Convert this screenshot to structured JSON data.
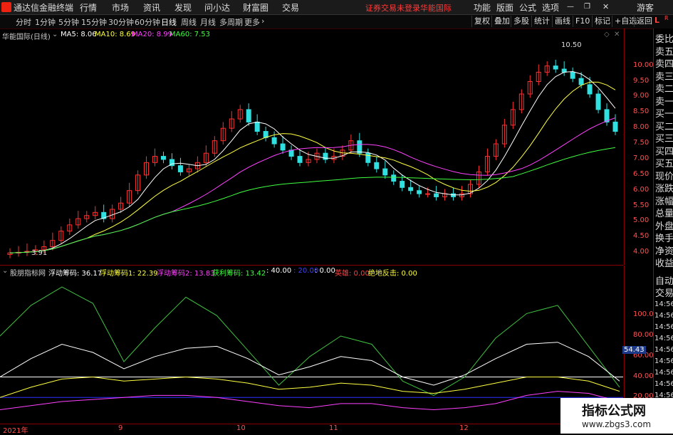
{
  "menubar": {
    "app_title": "通达信金融终端",
    "items": [
      "行情",
      "市场",
      "资讯",
      "发现",
      "问小达",
      "财富圈",
      "交易"
    ],
    "login_notice": "证券交易未登录",
    "stock_link": "华能国际",
    "right_items": [
      "功能",
      "版面",
      "公式",
      "选项"
    ],
    "user": "游客"
  },
  "toolbar": {
    "periods": [
      "分时",
      "1分钟",
      "5分钟",
      "15分钟",
      "30分钟",
      "60分钟",
      "日线",
      "周线",
      "月线",
      "多周期",
      "更多"
    ],
    "active_period": "日线",
    "right_buttons": [
      "复权",
      "叠加",
      "多股",
      "统计",
      "画线",
      "F10",
      "标记",
      "+自选",
      "返回"
    ]
  },
  "main_chart": {
    "title": "华能国际(日线)",
    "ma_labels": [
      {
        "text": "MA5: 8.06",
        "color": "#ffffff"
      },
      {
        "text": "MA10: 8.69",
        "color": "#ffff40"
      },
      {
        "text": "MA20: 8.99",
        "color": "#ff40ff"
      },
      {
        "text": "MA60: 7.53",
        "color": "#40ff40"
      }
    ],
    "high_label": "10.50",
    "low_label": "3.91"
  },
  "sub_chart": {
    "title": "股朋指标网",
    "items": [
      {
        "text": "浮动筹码: 36.17",
        "color": "#ffffff"
      },
      {
        "text": "浮动筹码1: 22.39",
        "color": "#ffff40"
      },
      {
        "text": "浮动筹码2: 13.83",
        "color": "#ff40ff"
      },
      {
        "text": "获利筹码: 13.42",
        "color": "#40ff40"
      },
      {
        "text": ": 40.00",
        "color": "#ffffff"
      },
      {
        "text": ": 20.00",
        "color": "#4040ff"
      },
      {
        "text": ": 0.00",
        "color": "#ffffff"
      },
      {
        "text": "英雄: 0.00",
        "color": "#ff4040"
      },
      {
        "text": "绝地反击: 0.00",
        "color": "#ffff40"
      }
    ],
    "current_value": "54.43"
  },
  "axis_main": [
    "10.00",
    "9.50",
    "9.00",
    "8.50",
    "8.00",
    "7.50",
    "7.00",
    "6.50",
    "6.00",
    "5.50",
    "5.00",
    "4.50",
    "4.00"
  ],
  "axis_sub": [
    "100.0",
    "80.00",
    "60.00",
    "40.00",
    "20.00"
  ],
  "side_panel": [
    "委比",
    "卖五",
    "卖四",
    "卖三",
    "卖二",
    "卖一",
    "买一",
    "买二",
    "买三",
    "买四",
    "买五",
    "现价",
    "涨跌",
    "涨幅",
    "总量",
    "外盘",
    "换手",
    "净资",
    "收益"
  ],
  "side_bottom": [
    "自动",
    "交易"
  ],
  "side_times": [
    "14:56",
    "14:56",
    "14:56",
    "14:56",
    "14:56",
    "14:56",
    "14:56",
    "14:56",
    "14:56",
    "14:56",
    "14:56"
  ],
  "date_axis": [
    "2021年",
    "9",
    "10",
    "11",
    "12"
  ],
  "watermark": {
    "title": "指标公式网",
    "url": "www.zbgs3.com"
  },
  "chart_data": {
    "type": "candlestick",
    "ylim": [
      3.8,
      10.7
    ],
    "x": [
      "2021年",
      "9",
      "10",
      "11",
      "12"
    ],
    "close": [
      4.0,
      4.02,
      4.05,
      4.1,
      4.2,
      4.4,
      4.7,
      4.9,
      5.1,
      5.2,
      5.3,
      5.1,
      5.4,
      5.6,
      6.0,
      6.5,
      6.9,
      7.1,
      7.0,
      6.8,
      6.6,
      6.7,
      6.9,
      7.2,
      7.6,
      8.0,
      8.3,
      8.6,
      8.2,
      7.9,
      7.7,
      7.5,
      7.3,
      7.1,
      6.9,
      7.0,
      7.2,
      7.0,
      7.1,
      7.3,
      7.6,
      7.2,
      6.9,
      6.7,
      6.5,
      6.3,
      6.1,
      6.0,
      5.9,
      5.9,
      5.8,
      5.9,
      5.8,
      5.9,
      6.2,
      6.6,
      7.1,
      7.5,
      8.1,
      8.6,
      9.1,
      9.5,
      9.8,
      10.0,
      9.9,
      9.8,
      9.6,
      9.4,
      9.1,
      8.6,
      8.2,
      7.9
    ],
    "ma5_last": 8.06,
    "ma10_last": 8.69,
    "ma20_last": 8.99,
    "ma60_last": 7.53,
    "sub_series": [
      {
        "name": "获利筹码",
        "values": [
          80,
          110,
          128,
          112,
          55,
          88,
          118,
          100,
          66,
          32,
          60,
          80,
          72,
          36,
          22,
          40,
          78,
          102,
          110,
          70,
          30
        ]
      },
      {
        "name": "浮动筹码",
        "values": [
          40,
          58,
          72,
          64,
          48,
          60,
          68,
          70,
          58,
          42,
          50,
          60,
          56,
          40,
          32,
          42,
          58,
          72,
          74,
          60,
          36
        ]
      },
      {
        "name": "浮动筹码1",
        "values": [
          20,
          30,
          38,
          40,
          36,
          38,
          40,
          38,
          34,
          28,
          30,
          34,
          32,
          26,
          24,
          28,
          34,
          40,
          40,
          36,
          26
        ]
      },
      {
        "name": "浮动筹码2",
        "values": [
          8,
          12,
          16,
          18,
          20,
          22,
          22,
          20,
          16,
          12,
          10,
          14,
          14,
          10,
          8,
          10,
          14,
          22,
          26,
          24,
          16
        ]
      }
    ]
  }
}
